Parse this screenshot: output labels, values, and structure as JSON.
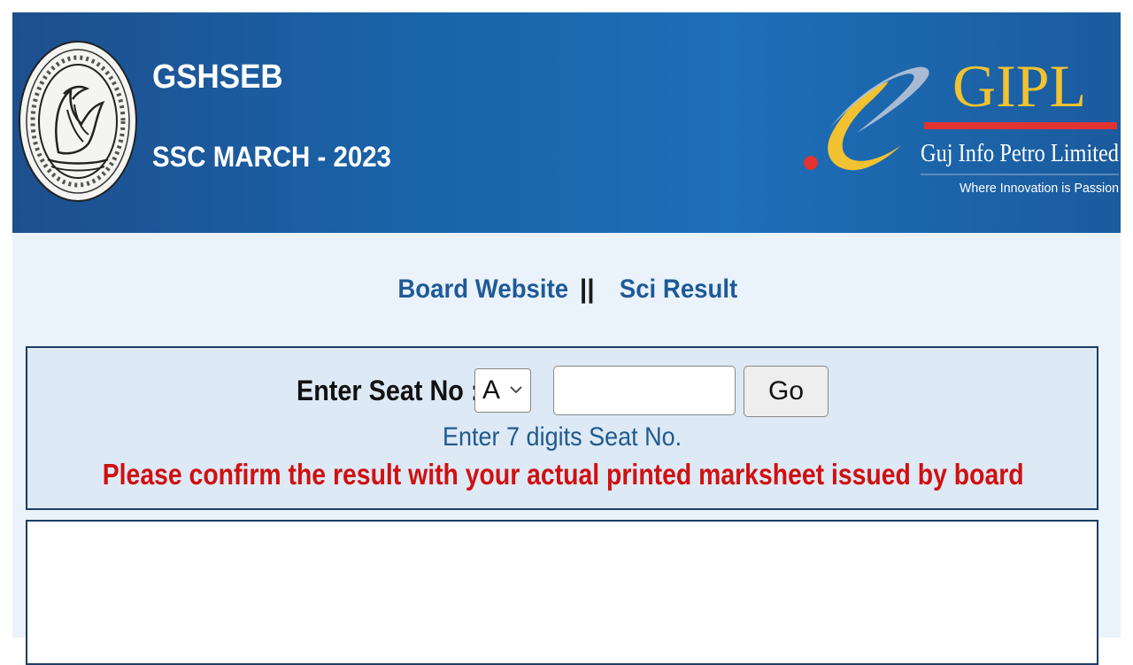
{
  "header": {
    "title": "GSHSEB",
    "subtitle": "SSC MARCH - 2023",
    "partner_logo": {
      "name": "GIPL",
      "company": "Guj Info Petro Limited",
      "tagline": "Where Innovation is Passion"
    },
    "seal_icon": "board-seal-icon"
  },
  "nav": {
    "board_website": "Board Website",
    "separator": "||",
    "sci_result": "Sci Result"
  },
  "form": {
    "seat_label": "Enter Seat No :",
    "series_selected": "A",
    "seat_value": "",
    "go_label": "Go",
    "hint": "Enter 7 digits Seat No.",
    "warning": "Please confirm the result with your actual printed marksheet issued by board"
  },
  "colors": {
    "header_bg": "#1a63a8",
    "link": "#1f5a98",
    "warning": "#d01010",
    "panel_border": "#1d3d66",
    "gipl_yellow": "#f2c230",
    "gipl_red": "#e23232"
  }
}
